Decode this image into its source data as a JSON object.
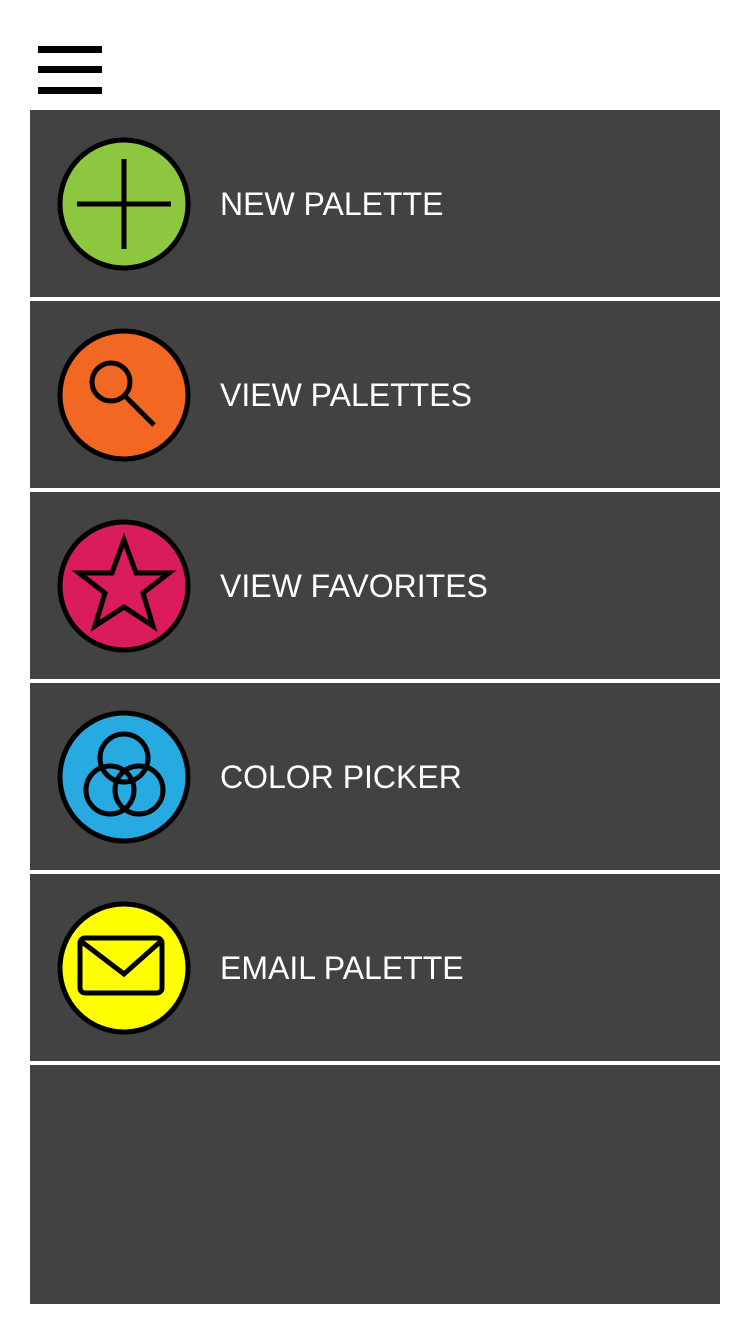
{
  "header": {
    "menu_icon": "hamburger-icon"
  },
  "menu": {
    "background": "#424242",
    "items": [
      {
        "label": "NEW PALETTE",
        "icon": "plus-icon",
        "color": "#8dc63f"
      },
      {
        "label": "VIEW PALETTES",
        "icon": "magnifier-icon",
        "color": "#f26722"
      },
      {
        "label": "VIEW FAVORITES",
        "icon": "star-icon",
        "color": "#da1c5c"
      },
      {
        "label": "COLOR PICKER",
        "icon": "color-circles-icon",
        "color": "#27aae1"
      },
      {
        "label": "EMAIL PALETTE",
        "icon": "envelope-icon",
        "color": "#ffff00"
      }
    ]
  }
}
